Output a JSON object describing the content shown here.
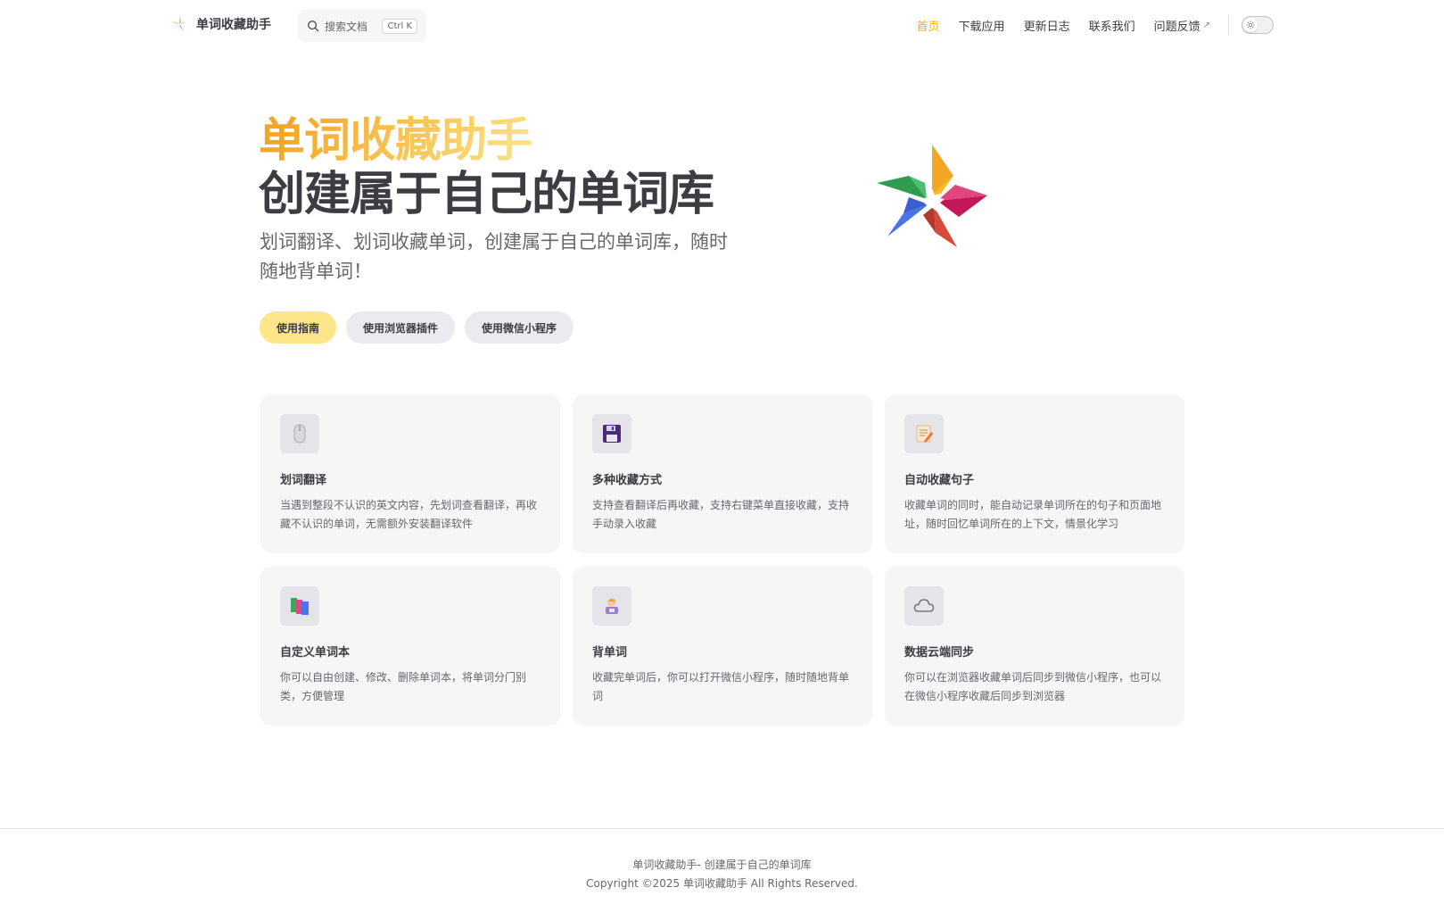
{
  "nav": {
    "title": "单词收藏助手",
    "search_placeholder": "搜索文档",
    "search_shortcut": "Ctrl K",
    "links": [
      {
        "label": "首页",
        "active": true
      },
      {
        "label": "下载应用"
      },
      {
        "label": "更新日志"
      },
      {
        "label": "联系我们"
      },
      {
        "label": "问题反馈",
        "external": true
      }
    ],
    "theme_icon": "sun-icon"
  },
  "hero": {
    "name": "单词收藏助手",
    "text": "创建属于自己的单词库",
    "tagline": "划词翻译、划词收藏单词，创建属于自己的单词库，随时随地背单词！",
    "image_icon": "pinwheel-star-logo",
    "actions": [
      {
        "label": "使用指南",
        "theme": "brand"
      },
      {
        "label": "使用浏览器插件",
        "theme": "alt"
      },
      {
        "label": "使用微信小程序",
        "theme": "alt"
      }
    ]
  },
  "features": [
    {
      "icon": "mouse-icon",
      "title": "划词翻译",
      "desc": "当遇到整段不认识的英文内容，先划词查看翻译，再收藏不认识的单词，无需额外安装翻译软件"
    },
    {
      "icon": "floppy-disk-icon",
      "title": "多种收藏方式",
      "desc": "支持查看翻译后再收藏，支持右键菜单直接收藏，支持手动录入收藏"
    },
    {
      "icon": "memo-icon",
      "title": "自动收藏句子",
      "desc": "收藏单词的同时，能自动记录单词所在的句子和页面地址，随时回忆单词所在的上下文，情景化学习"
    },
    {
      "icon": "books-icon",
      "title": "自定义单词本",
      "desc": "你可以自由创建、修改、删除单词本，将单词分门别类，方便管理"
    },
    {
      "icon": "student-icon",
      "title": "背单词",
      "desc": "收藏完单词后，你可以打开微信小程序，随时随地背单词"
    },
    {
      "icon": "cloud-icon",
      "title": "数据云端同步",
      "desc": "你可以在浏览器收藏单词后同步到微信小程序，也可以在微信小程序收藏后同步到浏览器"
    }
  ],
  "footer": {
    "message": "单词收藏助手- 创建属于自己的单词库",
    "copyright": "Copyright ©2025 单词收藏助手 All Rights Reserved."
  },
  "colors": {
    "brand": "#eab308",
    "brand_soft": "#fde68a",
    "text": "#3c3c43",
    "muted": "#67676c",
    "card_bg": "#f6f6f7"
  }
}
